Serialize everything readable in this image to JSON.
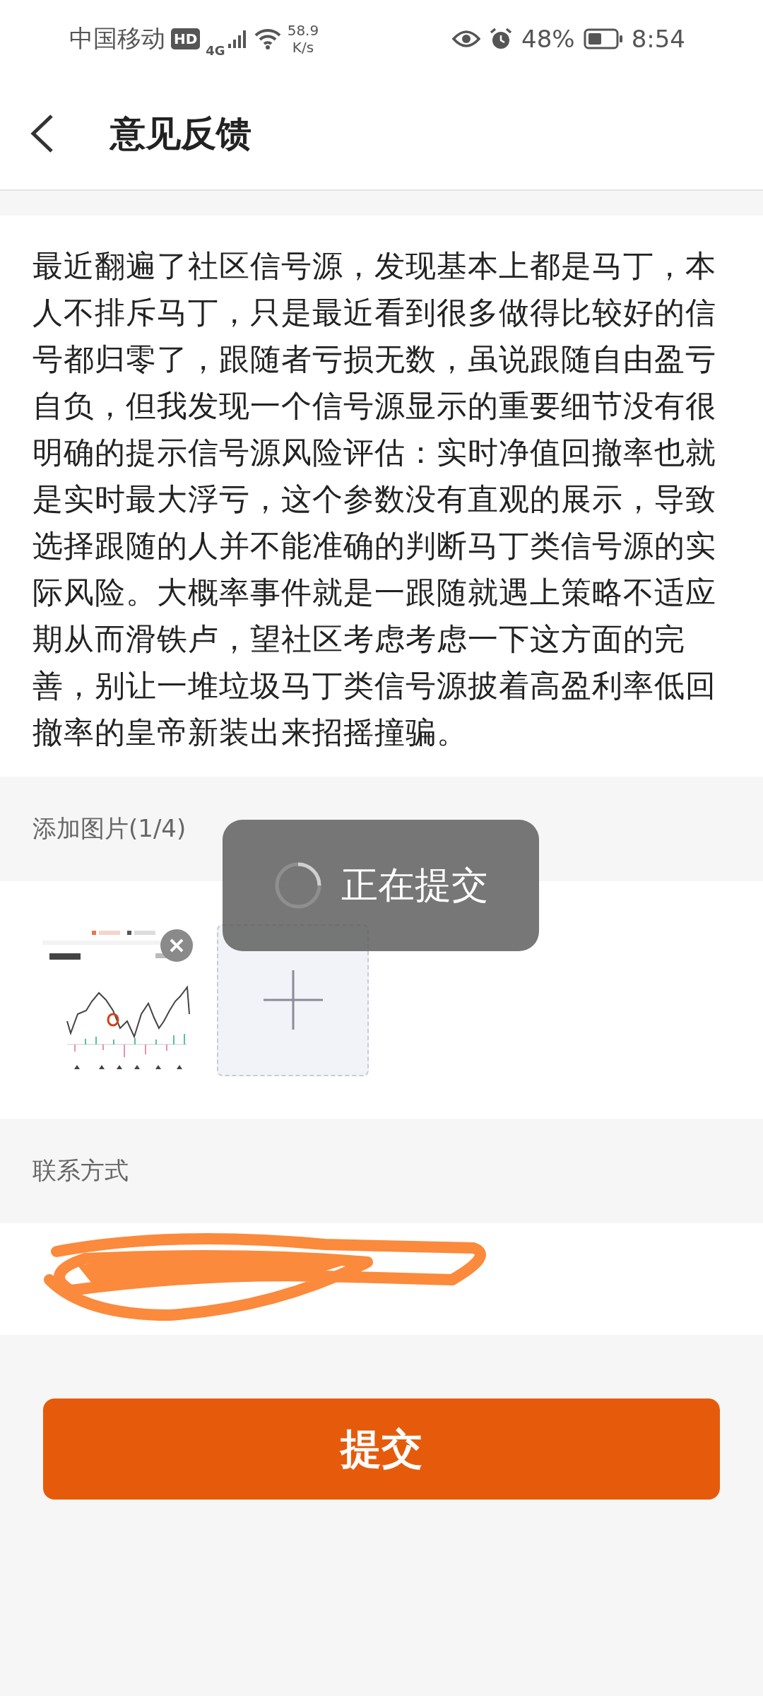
{
  "status_bar": {
    "carrier": "中国移动",
    "hd_badge": "HD",
    "network_type": "4G",
    "speed_value": "58.9",
    "speed_unit": "K/s",
    "battery": "48%",
    "time": "8:54"
  },
  "header": {
    "title": "意见反馈"
  },
  "feedback_text": "最近翻遍了社区信号源，发现基本上都是马丁，本人不排斥马丁，只是最近看到很多做得比较好的信号都归零了，跟随者亏损无数，虽说跟随自由盈亏自负，但我发现一个信号源显示的重要细节没有很明确的提示信号源风险评估：实时净值回撤率也就是实时最大浮亏，这个参数没有直观的展示，导致选择跟随的人并不能准确的判断马丁类信号源的实际风险。大概率事件就是一跟随就遇上策略不适应期从而滑铁卢，望社区考虑考虑一下这方面的完善，别让一堆垃圾马丁类信号源披着高盈利率低回撤率的皇帝新装出来招摇撞骗。",
  "toast": {
    "text": "正在提交"
  },
  "images_section": {
    "label": "添加图片(1/4)"
  },
  "contact_section": {
    "label": "联系方式"
  },
  "submit_button": {
    "label": "提交"
  }
}
